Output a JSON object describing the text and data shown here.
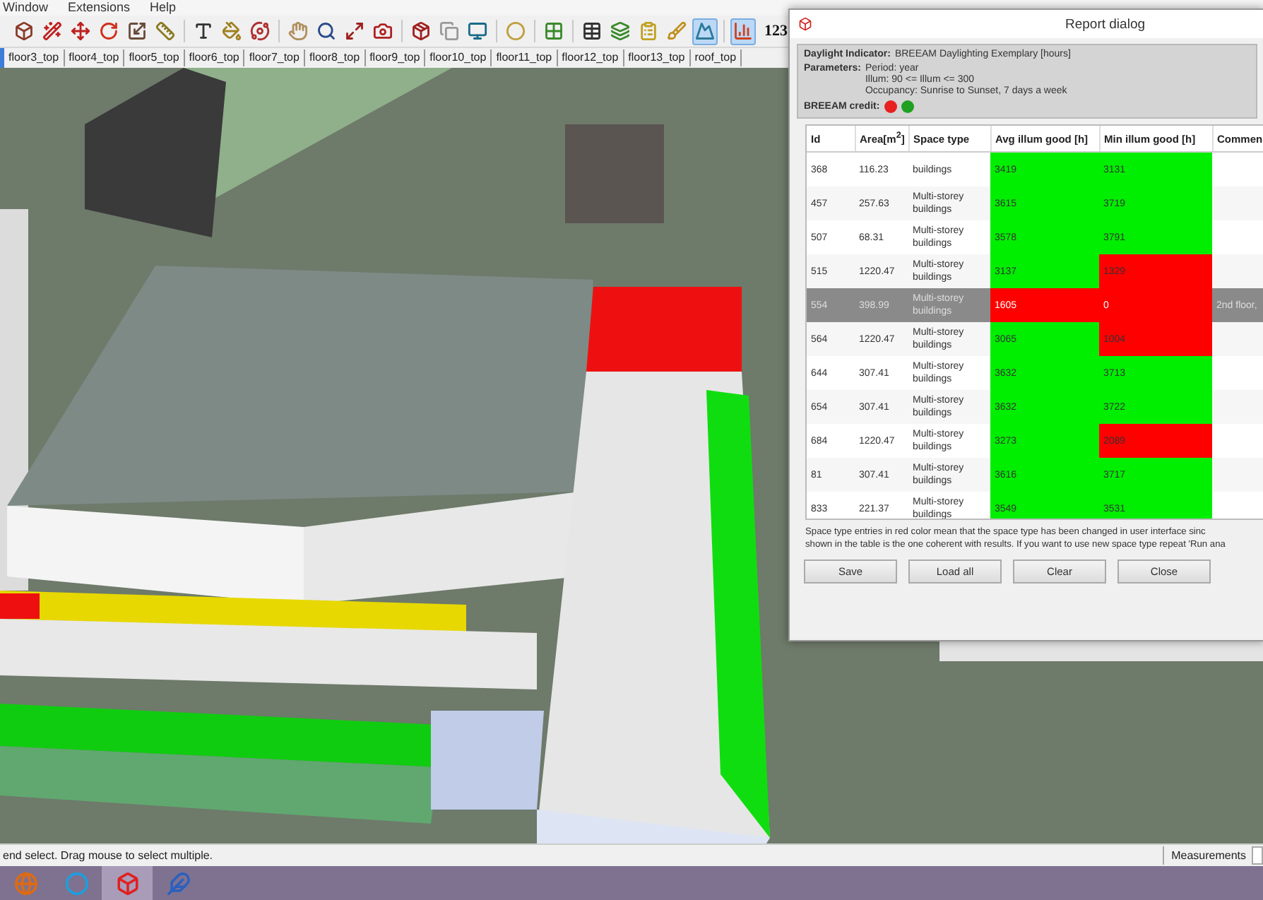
{
  "menu": [
    "Window",
    "Extensions",
    "Help"
  ],
  "toolbar": {
    "buttons": [
      {
        "pressed": false
      },
      {
        "pressed": false
      },
      {
        "pressed": false
      },
      {
        "pressed": false
      },
      {
        "pressed": false
      },
      {
        "pressed": false
      },
      {
        "pressed": false
      },
      {
        "pressed": false
      },
      {
        "pressed": false
      },
      {
        "pressed": false
      },
      {
        "pressed": false
      },
      {
        "pressed": false
      },
      {
        "pressed": false
      },
      {
        "pressed": false
      },
      {
        "pressed": false
      },
      {
        "pressed": false
      },
      {
        "pressed": false
      },
      {
        "pressed": false
      },
      {
        "pressed": false
      },
      {
        "pressed": false
      },
      {
        "pressed": false
      },
      {
        "pressed": false
      },
      {
        "pressed": true
      },
      {
        "pressed": true
      }
    ],
    "units_label": "123"
  },
  "scene_tabs": [
    {
      "label": "floor3_top",
      "selected": false
    },
    {
      "label": "floor4_top",
      "selected": false
    },
    {
      "label": "floor5_top",
      "selected": false
    },
    {
      "label": "floor6_top",
      "selected": false
    },
    {
      "label": "floor7_top",
      "selected": false
    },
    {
      "label": "floor8_top",
      "selected": false
    },
    {
      "label": "floor9_top",
      "selected": false
    },
    {
      "label": "floor10_top",
      "selected": false
    },
    {
      "label": "floor11_top",
      "selected": false
    },
    {
      "label": "floor12_top",
      "selected": false
    },
    {
      "label": "floor13_top",
      "selected": false
    },
    {
      "label": "roof_top",
      "selected": false
    }
  ],
  "dialog": {
    "title": "Report dialog",
    "indicator": {
      "label": "Daylight Indicator:",
      "value": "BREEAM Daylighting Exemplary [hours]"
    },
    "parameters": {
      "label": "Parameters:",
      "lines": [
        "Period: year",
        "Illum: 90 <= Illum <= 300",
        "Occupancy: Sunrise to Sunset, 7 days a week"
      ]
    },
    "credit": {
      "label": "BREEAM credit:",
      "lights": [
        {
          "color": "#e82020"
        },
        {
          "color": "#20a020"
        }
      ]
    },
    "table": {
      "columns": [
        "Id",
        "Area[m$^{2}$]",
        "Space type",
        "Avg illum good [h]",
        "Min illum good [h]",
        "Commen"
      ],
      "rows": [
        {
          "id": "368",
          "area": "116.23",
          "space_type": "buildings",
          "avg": {
            "value": "3419",
            "color": "#00ee00"
          },
          "min": {
            "value": "3131",
            "color": "#00ee00"
          },
          "selected": false
        },
        {
          "id": "457",
          "area": "257.63",
          "space_type": "Multi-storey buildings",
          "avg": {
            "value": "3615",
            "color": "#00ee00"
          },
          "min": {
            "value": "3719",
            "color": "#00ee00"
          },
          "selected": false
        },
        {
          "id": "507",
          "area": "68.31",
          "space_type": "Multi-storey buildings",
          "avg": {
            "value": "3578",
            "color": "#00ee00"
          },
          "min": {
            "value": "3791",
            "color": "#00ee00"
          },
          "selected": false
        },
        {
          "id": "515",
          "area": "1220.47",
          "space_type": "Multi-storey buildings",
          "avg": {
            "value": "3137",
            "color": "#00ee00"
          },
          "min": {
            "value": "1329",
            "color": "#ff0000"
          },
          "selected": false
        },
        {
          "id": "554",
          "area": "398.99",
          "space_type": "Multi-storey buildings",
          "avg": {
            "value": "1605",
            "color": "#ff0000"
          },
          "min": {
            "value": "0",
            "color": "#ff0000"
          },
          "comment": "2nd floor,",
          "selected": true
        },
        {
          "id": "564",
          "area": "1220.47",
          "space_type": "Multi-storey buildings",
          "avg": {
            "value": "3065",
            "color": "#00ee00"
          },
          "min": {
            "value": "1004",
            "color": "#ff0000"
          },
          "selected": false
        },
        {
          "id": "644",
          "area": "307.41",
          "space_type": "Multi-storey buildings",
          "avg": {
            "value": "3632",
            "color": "#00ee00"
          },
          "min": {
            "value": "3713",
            "color": "#00ee00"
          },
          "selected": false
        },
        {
          "id": "654",
          "area": "307.41",
          "space_type": "Multi-storey buildings",
          "avg": {
            "value": "3632",
            "color": "#00ee00"
          },
          "min": {
            "value": "3722",
            "color": "#00ee00"
          },
          "selected": false
        },
        {
          "id": "684",
          "area": "1220.47",
          "space_type": "Multi-storey buildings",
          "avg": {
            "value": "3273",
            "color": "#00ee00"
          },
          "min": {
            "value": "2089",
            "color": "#ff0000"
          },
          "selected": false
        },
        {
          "id": "81",
          "area": "307.41",
          "space_type": "Multi-storey buildings",
          "avg": {
            "value": "3616",
            "color": "#00ee00"
          },
          "min": {
            "value": "3717",
            "color": "#00ee00"
          },
          "selected": false
        },
        {
          "id": "833",
          "area": "221.37",
          "space_type": "Multi-storey buildings",
          "avg": {
            "value": "3549",
            "color": "#00ee00"
          },
          "min": {
            "value": "3531",
            "color": "#00ee00"
          },
          "selected": false
        }
      ]
    },
    "note_lines": [
      "Space type entries in red color mean that the space type has been changed in user interface sinc",
      "shown in the table is the one coherent with results. If you want to use new space type repeat 'Run ana"
    ],
    "buttons": [
      "Save",
      "Load all",
      "Clear",
      "Close"
    ]
  },
  "status_bar": {
    "message": "end select. Drag mouse to select multiple.",
    "measurements_label": "Measurements"
  },
  "taskbar": {
    "apps": [
      {
        "selected": false
      },
      {
        "selected": false
      },
      {
        "selected": true
      },
      {
        "selected": false
      }
    ]
  }
}
